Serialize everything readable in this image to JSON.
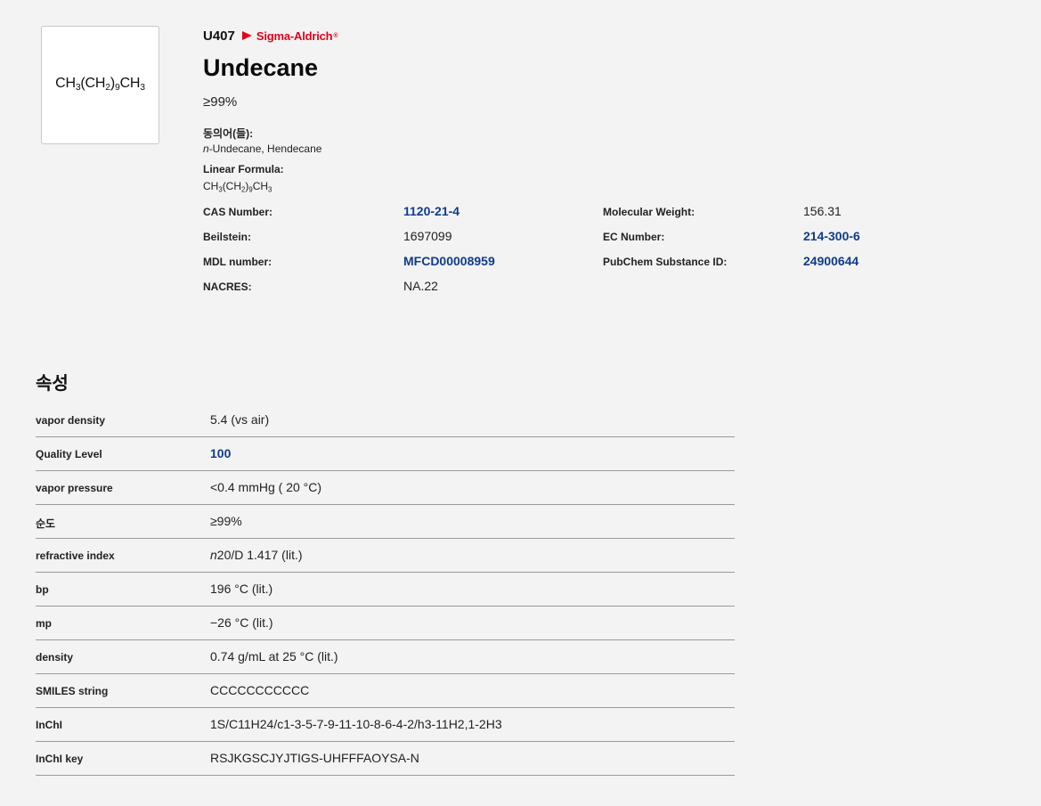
{
  "product": {
    "structure": {
      "pre": "CH",
      "s1": "3",
      "m1": "(CH",
      "s2": "2",
      "m2": ")",
      "s3": "9",
      "m3": "CH",
      "s4": "3"
    },
    "sku": "U407",
    "brand": "Sigma-Aldrich",
    "brand_reg": "®",
    "name": "Undecane",
    "assay": "≥99%",
    "synonyms_label": "동의어(들):",
    "synonyms_italic": "n",
    "synonyms_rest": "-Undecane, Hendecane",
    "linear_formula_label": "Linear Formula:",
    "linear_formula": {
      "pre": "CH",
      "s1": "3",
      "m1": "(CH",
      "s2": "2",
      "m2": ")",
      "s3": "9",
      "m3": "CH",
      "s4": "3"
    }
  },
  "identifiers": [
    {
      "label": "CAS Number:",
      "value": "1120-21-4",
      "link": true,
      "label2": "Molecular Weight:",
      "value2": "156.31",
      "link2": false
    },
    {
      "label": "Beilstein:",
      "value": "1697099",
      "link": false,
      "label2": "EC Number:",
      "value2": "214-300-6",
      "link2": true
    },
    {
      "label": "MDL number:",
      "value": "MFCD00008959",
      "link": true,
      "label2": "PubChem Substance ID:",
      "value2": "24900644",
      "link2": true
    },
    {
      "label": "NACRES:",
      "value": "NA.22",
      "link": false,
      "label2": "",
      "value2": "",
      "link2": false
    }
  ],
  "properties_heading": "속성",
  "properties": [
    {
      "label": "vapor density",
      "value": "5.4 (vs air)"
    },
    {
      "label": "Quality Level",
      "value": "100"
    },
    {
      "label": "vapor pressure",
      "value": "<0.4 mmHg ( 20 °C)"
    },
    {
      "label": "순도",
      "value": "≥99%"
    },
    {
      "label": "refractive index",
      "value_italic": "n",
      "value": "20/D 1.417 (lit.)"
    },
    {
      "label": "bp",
      "value": "196 °C (lit.)"
    },
    {
      "label": "mp",
      "value": "−26 °C (lit.)"
    },
    {
      "label": "density",
      "value": "0.74 g/mL at 25 °C (lit.)"
    },
    {
      "label": "SMILES string",
      "value": "CCCCCCCCCCC"
    },
    {
      "label": "InChI",
      "value": "1S/C11H24/c1-3-5-7-9-11-10-8-6-4-2/h3-11H2,1-2H3"
    },
    {
      "label": "InChI key",
      "value": "RSJKGSCJYJTIGS-UHFFFAOYSA-N"
    }
  ],
  "colors": {
    "link": "#0f3b8c",
    "brand": "#e3001b",
    "background": "#f3f3f3"
  }
}
